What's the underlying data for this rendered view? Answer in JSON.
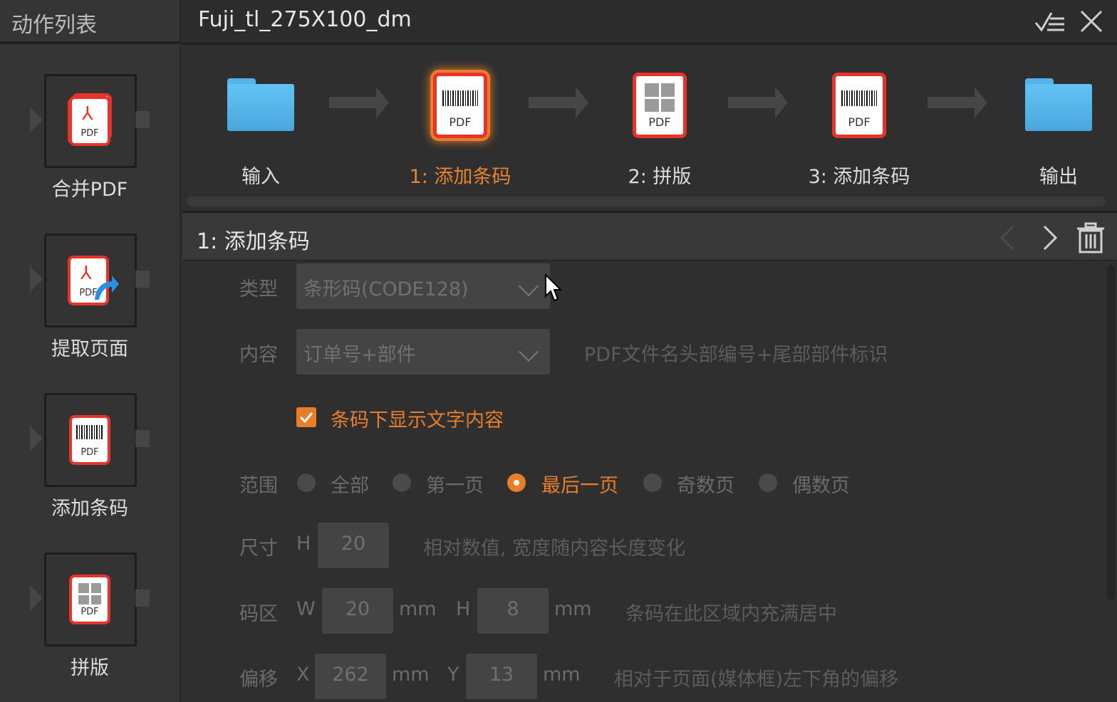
{
  "sidebar": {
    "title": "动作列表",
    "actions": [
      {
        "label": "合并PDF",
        "icon": "merge-pdf-icon"
      },
      {
        "label": "提取页面",
        "icon": "extract-pages-icon"
      },
      {
        "label": "添加条码",
        "icon": "add-barcode-icon"
      },
      {
        "label": "拼版",
        "icon": "imposition-icon"
      }
    ]
  },
  "header": {
    "title": "Fuji_tl_275X100_dm"
  },
  "workflow": {
    "steps": [
      {
        "label": "输入",
        "icon": "folder-icon"
      },
      {
        "label": "1: 添加条码",
        "icon": "add-barcode-icon",
        "active": true
      },
      {
        "label": "2: 拼版",
        "icon": "imposition-icon"
      },
      {
        "label": "3: 添加条码",
        "icon": "add-barcode-icon"
      },
      {
        "label": "输出",
        "icon": "folder-icon"
      }
    ],
    "pdf_text": "PDF"
  },
  "section": {
    "title": "1: 添加条码"
  },
  "form": {
    "type_label": "类型",
    "type_value": "条形码(CODE128)",
    "content_label": "内容",
    "content_value": "订单号+部件",
    "content_hint": "PDF文件名头部编号+尾部部件标识",
    "show_text_checkbox": {
      "label": "条码下显示文字内容",
      "checked": true
    },
    "range_label": "范围",
    "range_options": [
      "全部",
      "第一页",
      "最后一页",
      "奇数页",
      "偶数页"
    ],
    "range_selected": "最后一页",
    "size_label": "尺寸",
    "size_h_label": "H",
    "size_h_value": "20",
    "size_hint": "相对数值, 宽度随内容长度变化",
    "area_label": "码区",
    "area_w_label": "W",
    "area_w_value": "20",
    "area_h_label": "H",
    "area_h_value": "8",
    "unit_mm": "mm",
    "area_hint": "条码在此区域内充满居中",
    "offset_label": "偏移",
    "offset_x_label": "X",
    "offset_x_value": "262",
    "offset_y_label": "Y",
    "offset_y_value": "13",
    "offset_hint": "相对于页面(媒体框)左下角的偏移"
  },
  "colors": {
    "accent": "#e87e2a",
    "pdf_red": "#e8332b",
    "folder_blue": "#56b4ec"
  }
}
